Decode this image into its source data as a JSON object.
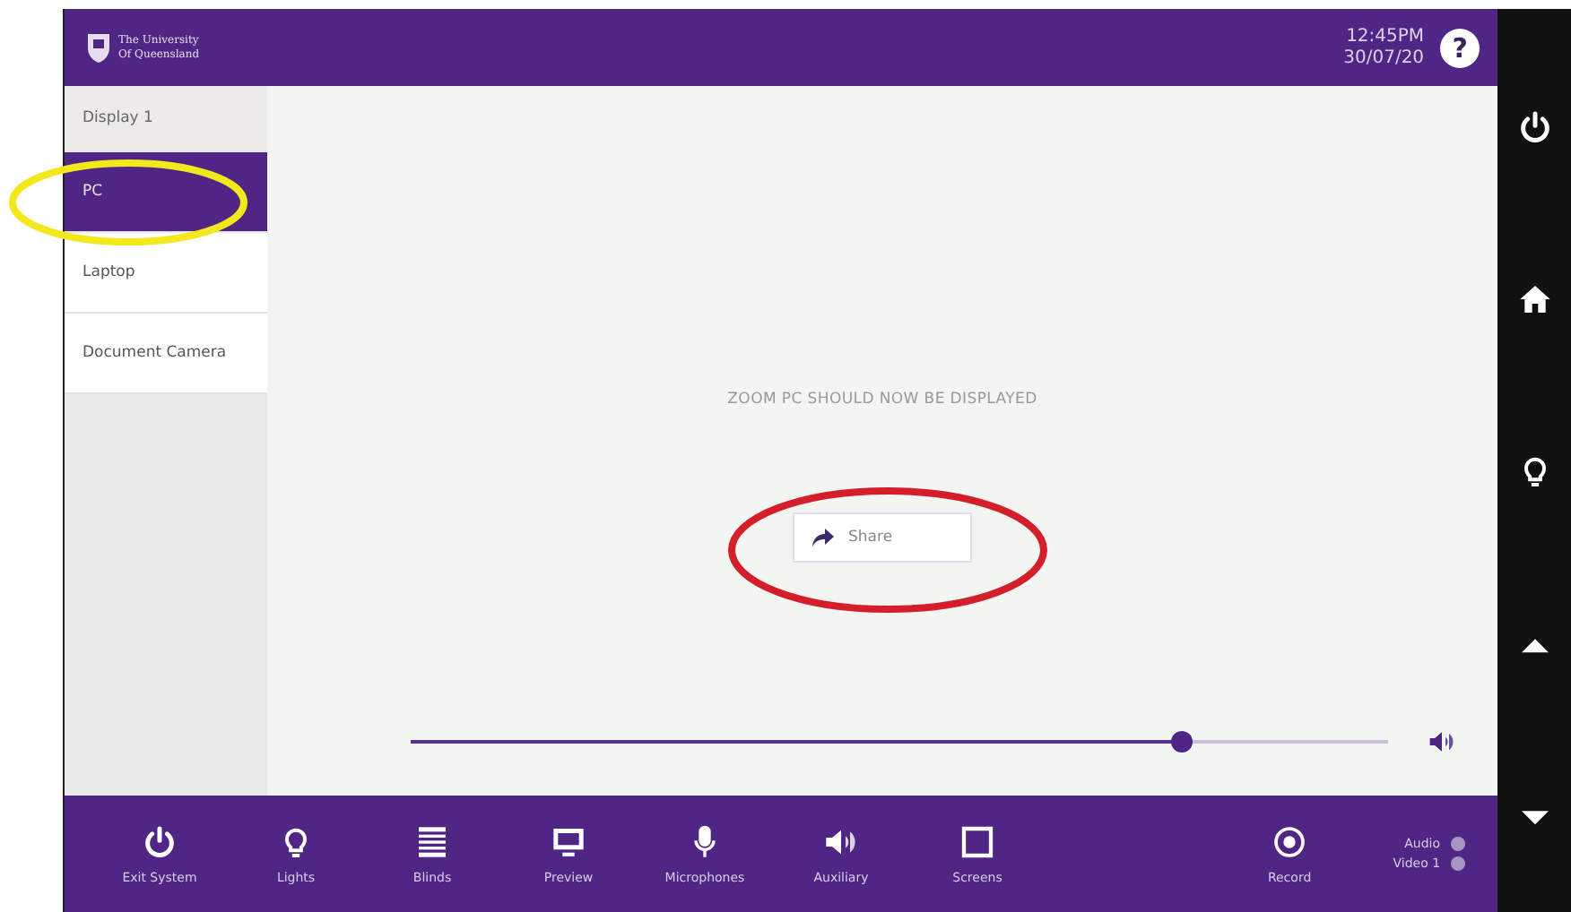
{
  "header": {
    "logo_lines": [
      "The University",
      "Of Queensland"
    ],
    "time": "12:45PM",
    "date": "30/07/20",
    "help": "?"
  },
  "sources": [
    {
      "label": "Display 1",
      "kind": "heading"
    },
    {
      "label": "PC",
      "kind": "item",
      "selected": true
    },
    {
      "label": "Laptop",
      "kind": "item",
      "selected": false
    },
    {
      "label": "Document Camera",
      "kind": "item",
      "selected": false
    }
  ],
  "main": {
    "message": "ZOOM PC SHOULD NOW BE DISPLAYED",
    "share_button": "Share",
    "volume": {
      "level": 0.79
    }
  },
  "bottom_bar": [
    {
      "label": "Exit System"
    },
    {
      "label": "Lights"
    },
    {
      "label": "Blinds"
    },
    {
      "label": "Preview"
    },
    {
      "label": "Microphones"
    },
    {
      "label": "Auxiliary"
    },
    {
      "label": "Screens"
    },
    {
      "label": "Record"
    }
  ],
  "status": [
    {
      "label": "Audio"
    },
    {
      "label": "Video 1"
    }
  ],
  "annotations": [
    {
      "kind": "ellipse",
      "color": "#f2e81c"
    },
    {
      "kind": "ellipse",
      "color": "#d41f2b"
    }
  ]
}
